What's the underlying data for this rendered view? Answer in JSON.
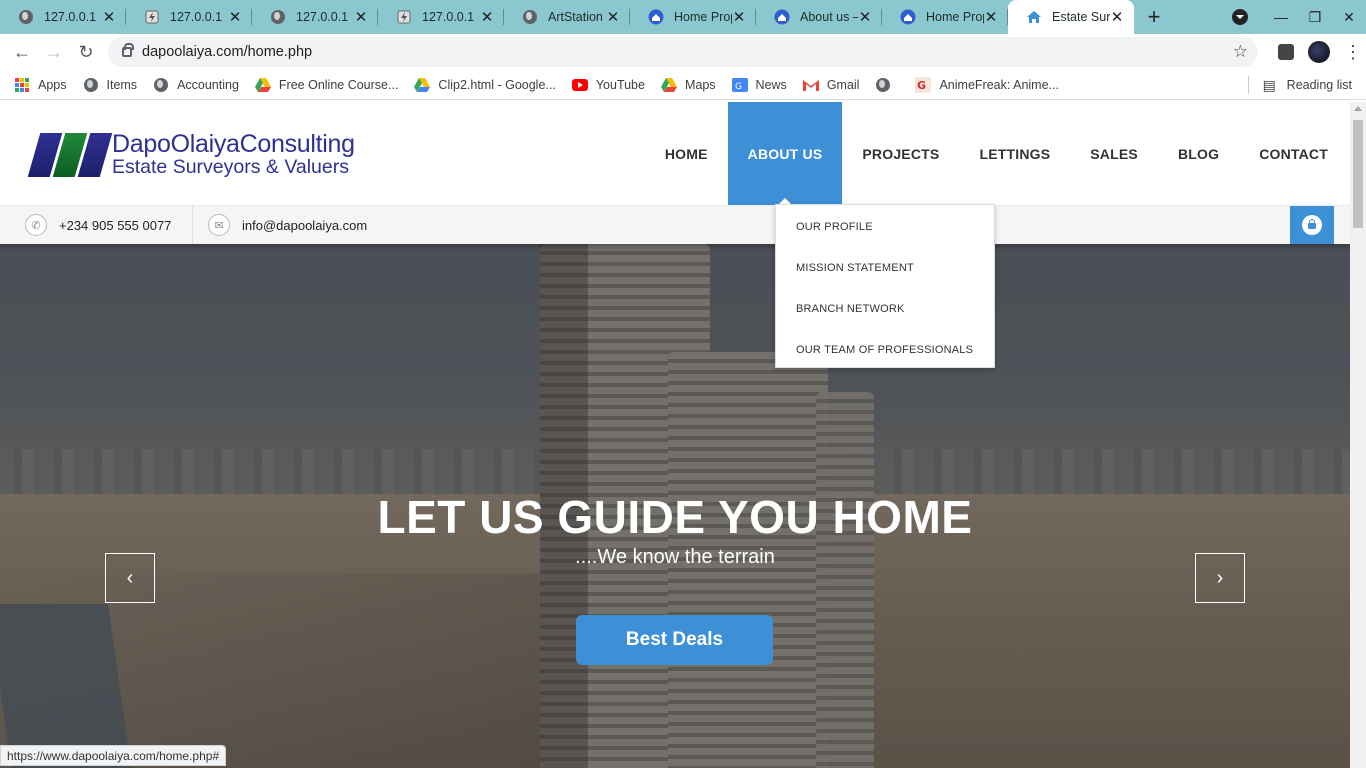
{
  "browser": {
    "tabs": [
      {
        "title": "127.0.0.1",
        "icon": "globe-icon"
      },
      {
        "title": "127.0.0.1",
        "icon": "lightning-page-icon"
      },
      {
        "title": "127.0.0.1",
        "icon": "globe-icon"
      },
      {
        "title": "127.0.0.1",
        "icon": "lightning-page-icon"
      },
      {
        "title": "ArtStation -",
        "icon": "globe-icon"
      },
      {
        "title": "Home Prop",
        "icon": "home-badge-icon"
      },
      {
        "title": "About us –",
        "icon": "home-badge-icon"
      },
      {
        "title": "Home Prop",
        "icon": "home-badge-icon"
      },
      {
        "title": "Estate Surv",
        "icon": "house-icon",
        "active": true
      }
    ],
    "address": "dapoolaiya.com/home.php",
    "bookmarks": [
      {
        "label": "Apps",
        "icon": "apps-grid-icon"
      },
      {
        "label": "Items",
        "icon": "globe-icon"
      },
      {
        "label": "Accounting",
        "icon": "globe-icon"
      },
      {
        "label": "Free Online Course...",
        "icon": "drive-icon"
      },
      {
        "label": "Clip2.html - Google...",
        "icon": "drive-icon"
      },
      {
        "label": "YouTube",
        "icon": "youtube-icon"
      },
      {
        "label": "Maps",
        "icon": "maps-icon"
      },
      {
        "label": "News",
        "icon": "news-icon"
      },
      {
        "label": "Gmail",
        "icon": "gmail-icon"
      },
      {
        "label": "",
        "icon": "globe-icon"
      },
      {
        "label": "AnimeFreak: Anime...",
        "icon": "animefreak-icon"
      }
    ],
    "reading_list": "Reading list",
    "status_url": "https://www.dapoolaiya.com/home.php#"
  },
  "site": {
    "logo": {
      "line1": "DapoOlaiyaConsulting",
      "line2": "Estate Surveyors & Valuers"
    },
    "nav": [
      {
        "label": "HOME"
      },
      {
        "label": "ABOUT US",
        "active": true
      },
      {
        "label": "PROJECTS"
      },
      {
        "label": "LETTINGS"
      },
      {
        "label": "SALES"
      },
      {
        "label": "BLOG"
      },
      {
        "label": "CONTACT"
      }
    ],
    "dropdown": [
      "OUR PROFILE",
      "MISSION STATEMENT",
      "BRANCH NETWORK",
      "OUR TEAM OF PROFESSIONALS"
    ],
    "contact": {
      "phone": "+234 905 555 0077",
      "email": "info@dapoolaiya.com"
    },
    "hero": {
      "title": "LET US GUIDE YOU HOME",
      "subtitle": "....We know the terrain",
      "cta": "Best Deals",
      "prev": "‹",
      "next": "›"
    }
  },
  "colors": {
    "accent": "#3d8fd6",
    "brand": "#2e3192",
    "tabstrip": "#8bc7cf"
  }
}
